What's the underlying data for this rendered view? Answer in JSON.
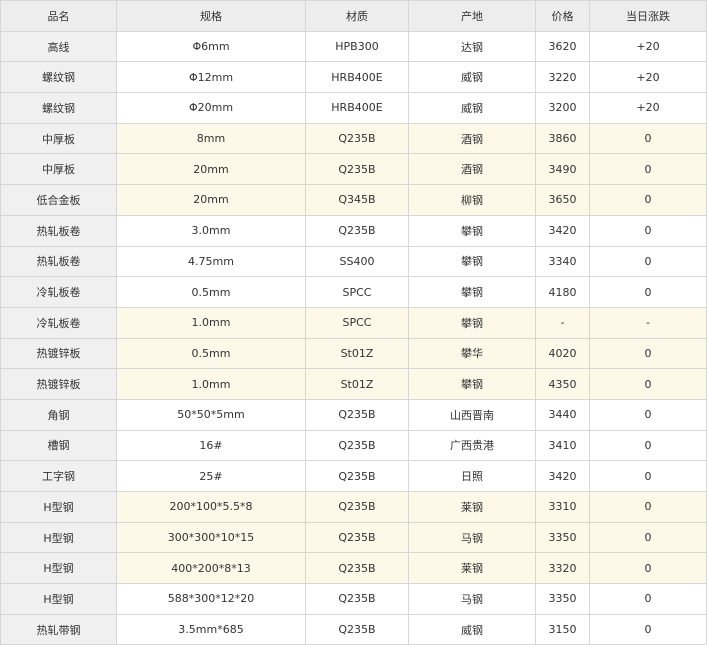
{
  "headers": [
    "品名",
    "规格",
    "材质",
    "产地",
    "价格",
    "当日涨跌"
  ],
  "rows": [
    {
      "name": "高线",
      "spec": "Φ6mm",
      "material": "HPB300",
      "origin": "达钢",
      "price": "3620",
      "change": "+20",
      "highlight": false
    },
    {
      "name": "螺纹钢",
      "spec": "Φ12mm",
      "material": "HRB400E",
      "origin": "威钢",
      "price": "3220",
      "change": "+20",
      "highlight": false
    },
    {
      "name": "螺纹钢",
      "spec": "Φ20mm",
      "material": "HRB400E",
      "origin": "威钢",
      "price": "3200",
      "change": "+20",
      "highlight": false
    },
    {
      "name": "中厚板",
      "spec": "8mm",
      "material": "Q235B",
      "origin": "酒钢",
      "price": "3860",
      "change": "0",
      "highlight": true
    },
    {
      "name": "中厚板",
      "spec": "20mm",
      "material": "Q235B",
      "origin": "酒钢",
      "price": "3490",
      "change": "0",
      "highlight": true
    },
    {
      "name": "低合金板",
      "spec": "20mm",
      "material": "Q345B",
      "origin": "柳钢",
      "price": "3650",
      "change": "0",
      "highlight": true
    },
    {
      "name": "热轧板卷",
      "spec": "3.0mm",
      "material": "Q235B",
      "origin": "攀钢",
      "price": "3420",
      "change": "0",
      "highlight": false
    },
    {
      "name": "热轧板卷",
      "spec": "4.75mm",
      "material": "SS400",
      "origin": "攀钢",
      "price": "3340",
      "change": "0",
      "highlight": false
    },
    {
      "name": "冷轧板卷",
      "spec": "0.5mm",
      "material": "SPCC",
      "origin": "攀钢",
      "price": "4180",
      "change": "0",
      "highlight": false
    },
    {
      "name": "冷轧板卷",
      "spec": "1.0mm",
      "material": "SPCC",
      "origin": "攀钢",
      "price": "-",
      "change": "-",
      "highlight": true
    },
    {
      "name": "热镀锌板",
      "spec": "0.5mm",
      "material": "St01Z",
      "origin": "攀华",
      "price": "4020",
      "change": "0",
      "highlight": true
    },
    {
      "name": "热镀锌板",
      "spec": "1.0mm",
      "material": "St01Z",
      "origin": "攀钢",
      "price": "4350",
      "change": "0",
      "highlight": true
    },
    {
      "name": "角钢",
      "spec": "50*50*5mm",
      "material": "Q235B",
      "origin": "山西晋南",
      "price": "3440",
      "change": "0",
      "highlight": false
    },
    {
      "name": "槽钢",
      "spec": "16#",
      "material": "Q235B",
      "origin": "广西贵港",
      "price": "3410",
      "change": "0",
      "highlight": false
    },
    {
      "name": "工字钢",
      "spec": "25#",
      "material": "Q235B",
      "origin": "日照",
      "price": "3420",
      "change": "0",
      "highlight": false
    },
    {
      "name": "H型钢",
      "spec": "200*100*5.5*8",
      "material": "Q235B",
      "origin": "莱钢",
      "price": "3310",
      "change": "0",
      "highlight": true
    },
    {
      "name": "H型钢",
      "spec": "300*300*10*15",
      "material": "Q235B",
      "origin": "马钢",
      "price": "3350",
      "change": "0",
      "highlight": true
    },
    {
      "name": "H型钢",
      "spec": "400*200*8*13",
      "material": "Q235B",
      "origin": "莱钢",
      "price": "3320",
      "change": "0",
      "highlight": true
    },
    {
      "name": "H型钢",
      "spec": "588*300*12*20",
      "material": "Q235B",
      "origin": "马钢",
      "price": "3350",
      "change": "0",
      "highlight": false
    },
    {
      "name": "热轧带钢",
      "spec": "3.5mm*685",
      "material": "Q235B",
      "origin": "威钢",
      "price": "3150",
      "change": "0",
      "highlight": false
    }
  ]
}
